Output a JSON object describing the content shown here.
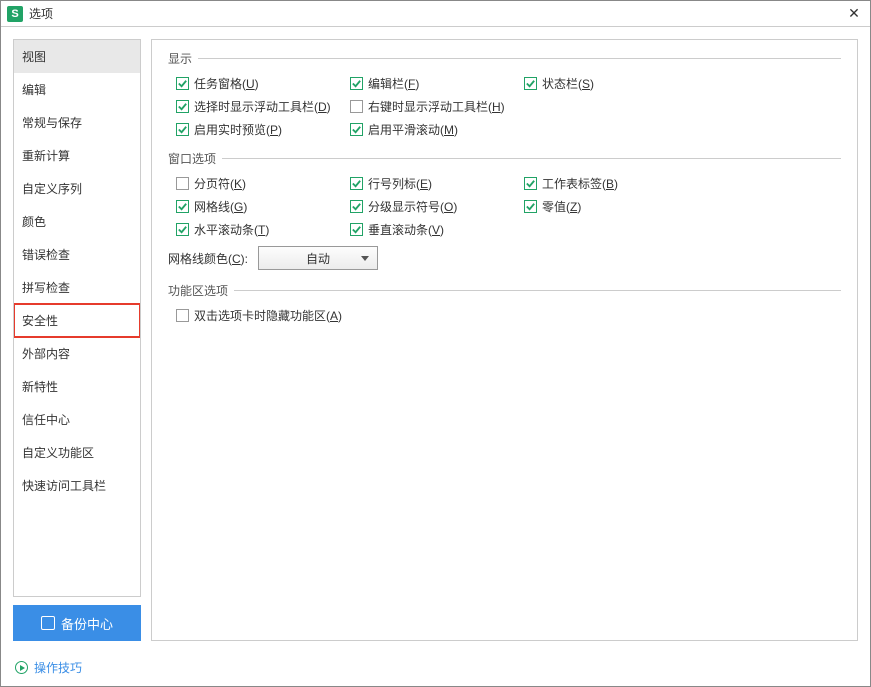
{
  "window": {
    "title": "选项"
  },
  "sidebar": {
    "items": [
      {
        "label": "视图"
      },
      {
        "label": "编辑"
      },
      {
        "label": "常规与保存"
      },
      {
        "label": "重新计算"
      },
      {
        "label": "自定义序列"
      },
      {
        "label": "颜色"
      },
      {
        "label": "错误检查"
      },
      {
        "label": "拼写检查"
      },
      {
        "label": "安全性"
      },
      {
        "label": "外部内容"
      },
      {
        "label": "新特性"
      },
      {
        "label": "信任中心"
      },
      {
        "label": "自定义功能区"
      },
      {
        "label": "快速访问工具栏"
      }
    ],
    "backup": "备份中心"
  },
  "tips": "操作技巧",
  "sections": {
    "display": {
      "title": "显示"
    },
    "window_opts": {
      "title": "窗口选项"
    },
    "ribbon": {
      "title": "功能区选项"
    }
  },
  "checkboxes": {
    "task_pane": {
      "text": "任务窗格",
      "hotkey": "U",
      "checked": true
    },
    "edit_bar": {
      "text": "编辑栏",
      "hotkey": "F",
      "checked": true
    },
    "status_bar": {
      "text": "状态栏",
      "hotkey": "S",
      "checked": true
    },
    "float_toolbar_sel": {
      "text": "选择时显示浮动工具栏",
      "hotkey": "D",
      "checked": true
    },
    "float_toolbar_rc": {
      "text": "右键时显示浮动工具栏",
      "hotkey": "H",
      "checked": false
    },
    "live_preview": {
      "text": "启用实时预览",
      "hotkey": "P",
      "checked": true
    },
    "smooth_scroll": {
      "text": "启用平滑滚动",
      "hotkey": "M",
      "checked": true
    },
    "page_break": {
      "text": "分页符",
      "hotkey": "K",
      "checked": false
    },
    "row_col_header": {
      "text": "行号列标",
      "hotkey": "E",
      "checked": true
    },
    "sheet_tabs": {
      "text": "工作表标签",
      "hotkey": "B",
      "checked": true
    },
    "gridlines": {
      "text": "网格线",
      "hotkey": "G",
      "checked": true
    },
    "outline_symbols": {
      "text": "分级显示符号",
      "hotkey": "O",
      "checked": true
    },
    "zero_values": {
      "text": "零值",
      "hotkey": "Z",
      "checked": true
    },
    "hscroll": {
      "text": "水平滚动条",
      "hotkey": "T",
      "checked": true
    },
    "vscroll": {
      "text": "垂直滚动条",
      "hotkey": "V",
      "checked": true
    },
    "dblclick_hide": {
      "text": "双击选项卡时隐藏功能区",
      "hotkey": "A",
      "checked": false
    }
  },
  "grid_color": {
    "label_text": "网格线颜色",
    "label_hotkey": "C",
    "value": "自动"
  }
}
